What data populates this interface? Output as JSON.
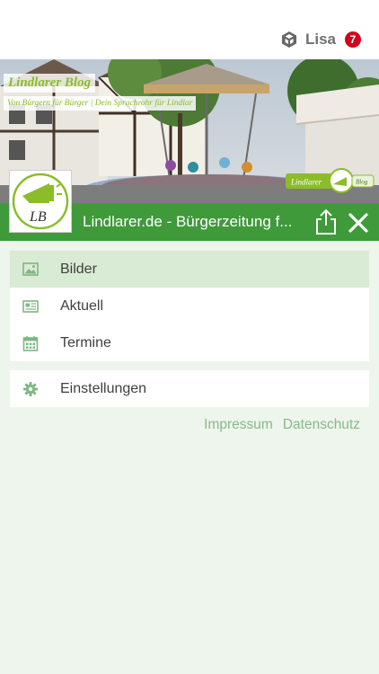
{
  "user": {
    "name": "Lisa",
    "notification_count": "7",
    "icon": "cube-icon"
  },
  "header": {
    "blog_title": "Lindlarer Blog",
    "tagline": "Von Bürgern für Bürger | Dein Sprachrohr für Lindlar",
    "corner_logo_text": "Lindlarer",
    "corner_logo_badge": "Blog",
    "avatar_text": "LB"
  },
  "titlebar": {
    "title": "Lindlarer.de - Bürgerzeitung f..."
  },
  "menu": {
    "items": [
      {
        "label": "Bilder",
        "icon": "image-icon",
        "active": true
      },
      {
        "label": "Aktuell",
        "icon": "newspaper-icon",
        "active": false
      },
      {
        "label": "Termine",
        "icon": "calendar-icon",
        "active": false
      }
    ],
    "settings": {
      "label": "Einstellungen",
      "icon": "gear-icon"
    }
  },
  "footer": {
    "impressum": "Impressum",
    "datenschutz": "Datenschutz"
  },
  "colors": {
    "brand_green": "#3f9a3a",
    "accent_lime": "#8bbd2a",
    "active_row": "#d9ead5",
    "badge_red": "#d0021b"
  }
}
